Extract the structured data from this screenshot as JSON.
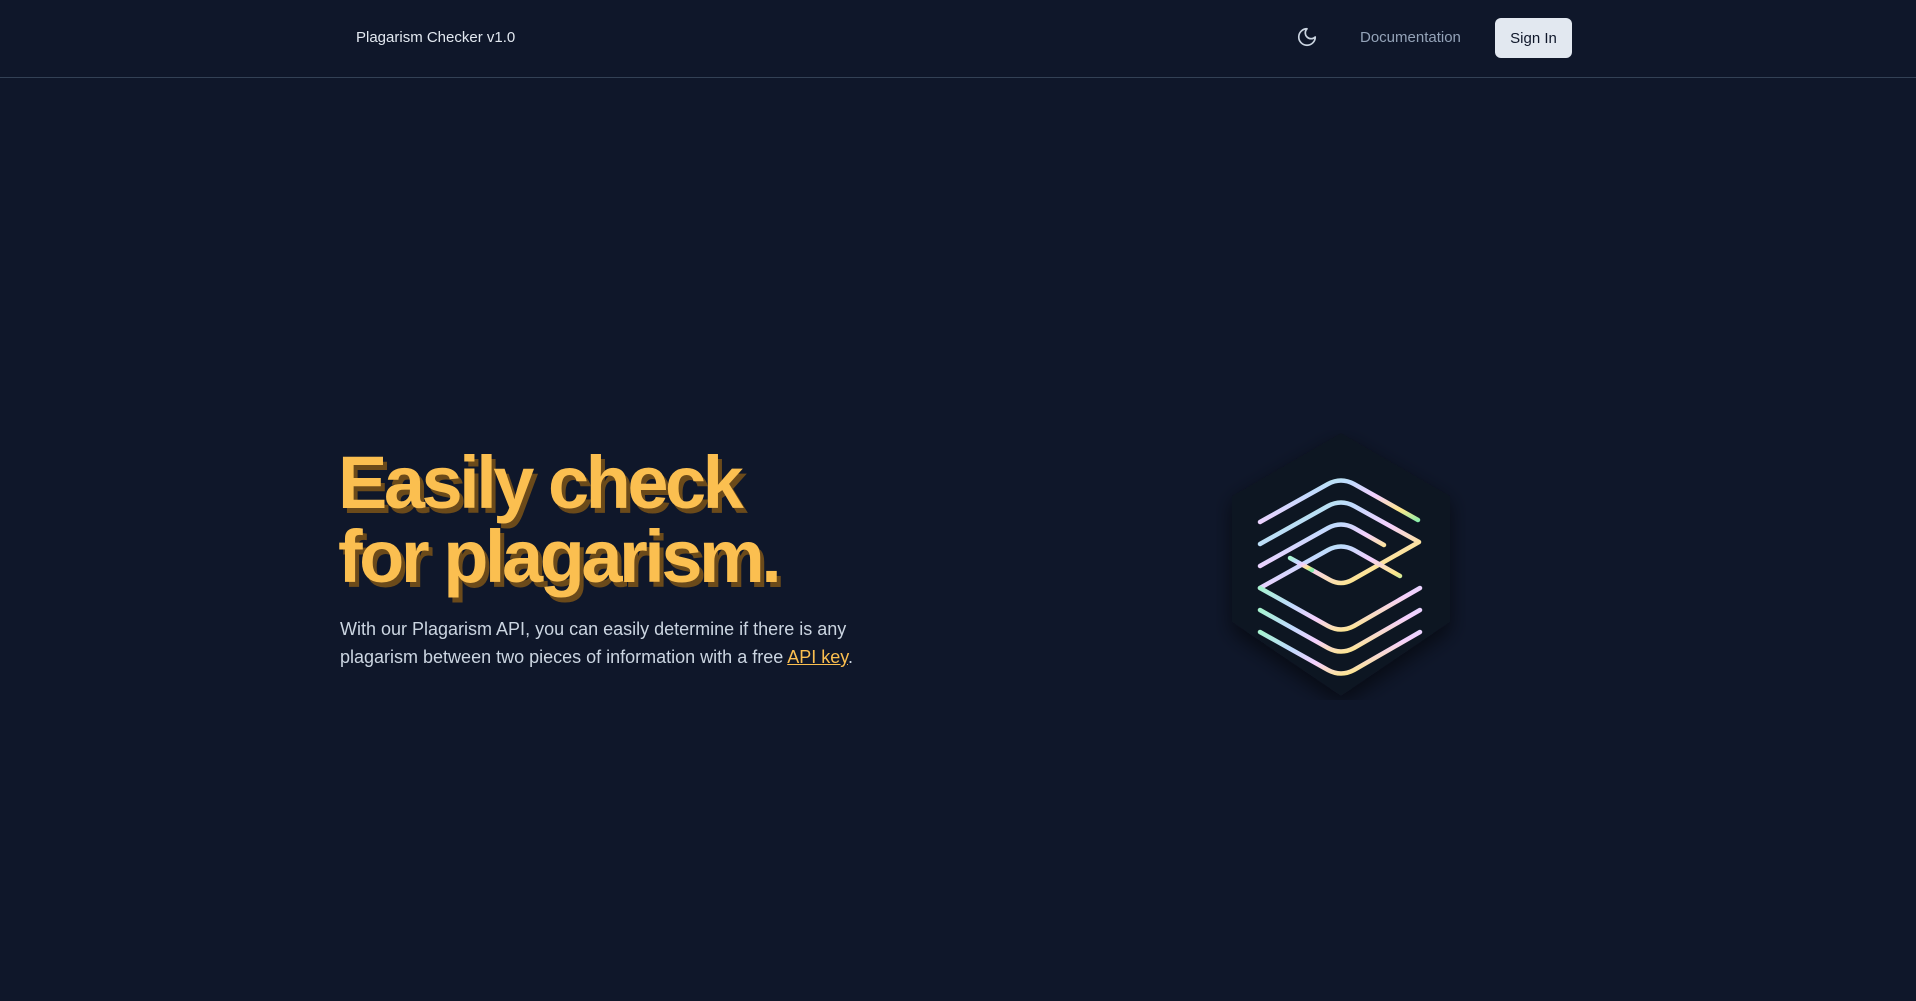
{
  "nav": {
    "brand": "Plagarism Checker v1.0",
    "theme_icon": "moon-icon",
    "documentation_label": "Documentation",
    "signin_label": "Sign In"
  },
  "hero": {
    "title_line1": "Easily check",
    "title_line2": "for plagarism.",
    "description_prefix": "With our Plagarism API, you can easily determine if there is any plagarism between two pieces of information with a free ",
    "api_link_label": "API key",
    "description_suffix": ".",
    "logo_icon": "layers-hexagon-icon"
  },
  "colors": {
    "background": "#0f172a",
    "accent": "#fbbf50",
    "button_bg": "#e2e8f0"
  }
}
